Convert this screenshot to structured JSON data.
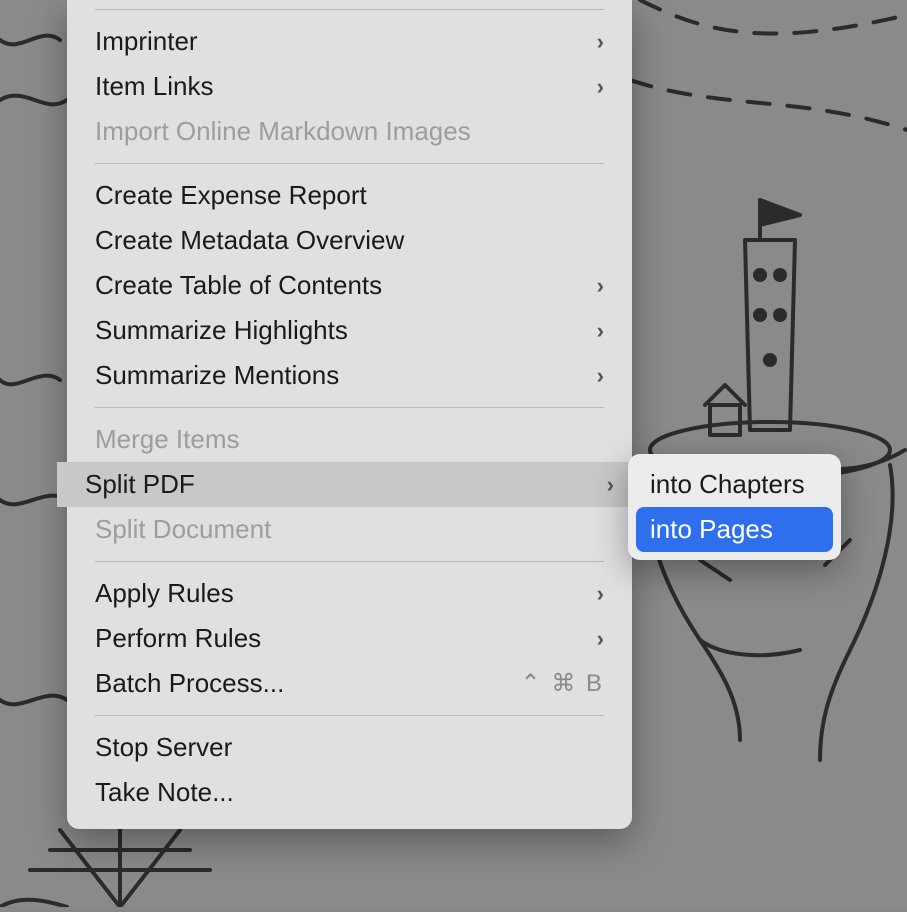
{
  "menu": {
    "items": [
      {
        "label": "Imprinter",
        "hasSubmenu": true,
        "disabled": false
      },
      {
        "label": "Item Links",
        "hasSubmenu": true,
        "disabled": false
      },
      {
        "label": "Import Online Markdown Images",
        "hasSubmenu": false,
        "disabled": true
      },
      {
        "label": "Create Expense Report",
        "hasSubmenu": false,
        "disabled": false
      },
      {
        "label": "Create Metadata Overview",
        "hasSubmenu": false,
        "disabled": false
      },
      {
        "label": "Create Table of Contents",
        "hasSubmenu": true,
        "disabled": false
      },
      {
        "label": "Summarize Highlights",
        "hasSubmenu": true,
        "disabled": false
      },
      {
        "label": "Summarize Mentions",
        "hasSubmenu": true,
        "disabled": false
      },
      {
        "label": "Merge Items",
        "hasSubmenu": false,
        "disabled": true
      },
      {
        "label": "Split PDF",
        "hasSubmenu": true,
        "disabled": false,
        "highlighted": true
      },
      {
        "label": "Split Document",
        "hasSubmenu": false,
        "disabled": true
      },
      {
        "label": "Apply Rules",
        "hasSubmenu": true,
        "disabled": false
      },
      {
        "label": "Perform Rules",
        "hasSubmenu": true,
        "disabled": false
      },
      {
        "label": "Batch Process...",
        "hasSubmenu": false,
        "disabled": false,
        "shortcut": "⌃ ⌘ B"
      },
      {
        "label": "Stop Server",
        "hasSubmenu": false,
        "disabled": false
      },
      {
        "label": "Take Note...",
        "hasSubmenu": false,
        "disabled": false
      }
    ]
  },
  "submenu": {
    "items": [
      {
        "label": "into Chapters",
        "selected": false
      },
      {
        "label": "into Pages",
        "selected": true
      }
    ]
  }
}
